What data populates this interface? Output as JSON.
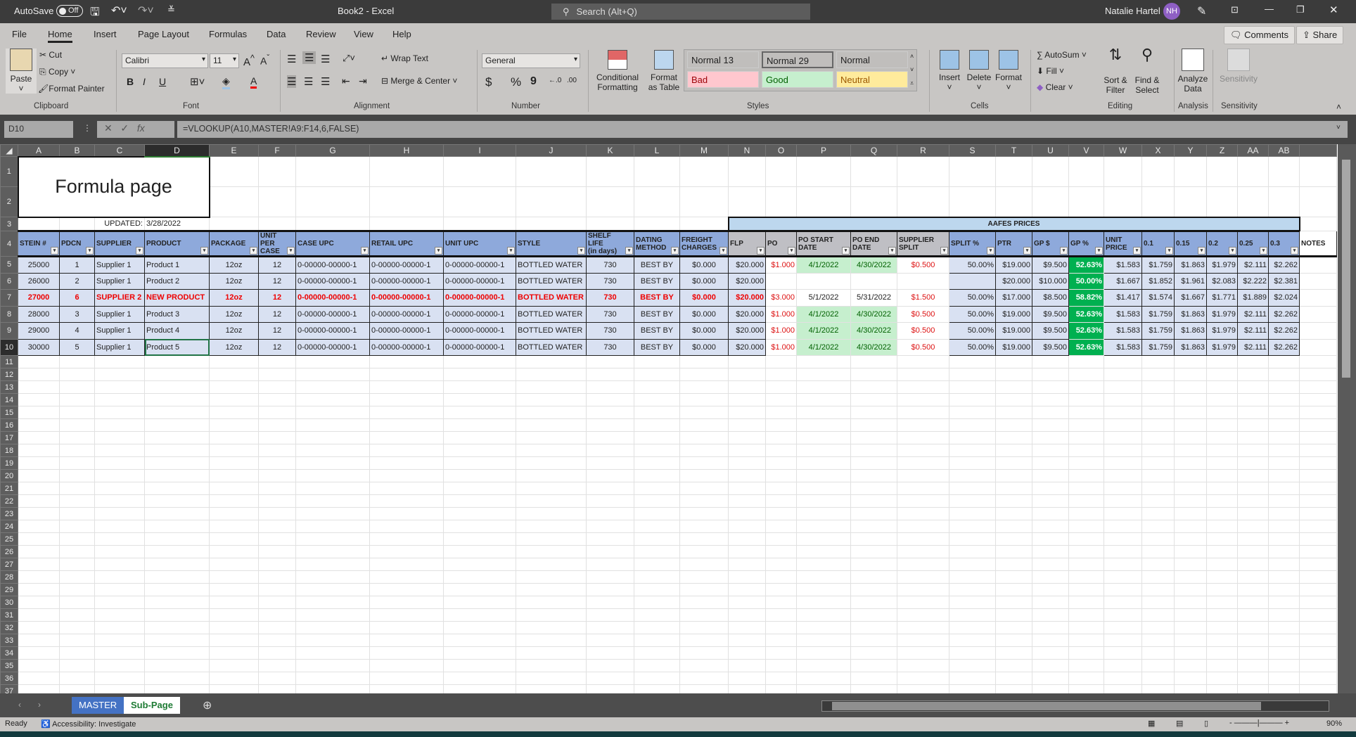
{
  "title_bar": {
    "autosave_label": "AutoSave",
    "autosave_state": "Off",
    "doc_title": "Book2  -  Excel",
    "search_placeholder": "Search (Alt+Q)",
    "user_name": "Natalie Hartel",
    "user_initials": "NH"
  },
  "menu_tabs": [
    "File",
    "Home",
    "Insert",
    "Page Layout",
    "Formulas",
    "Data",
    "Review",
    "View",
    "Help"
  ],
  "active_tab": "Home",
  "comments_label": "Comments",
  "share_label": "Share",
  "ribbon": {
    "clipboard": {
      "paste": "Paste",
      "cut": "Cut",
      "copy": "Copy",
      "format_painter": "Format Painter",
      "label": "Clipboard"
    },
    "font": {
      "name": "Calibri",
      "size": "11",
      "bold": "B",
      "italic": "I",
      "underline": "U",
      "label": "Font"
    },
    "alignment": {
      "wrap_text": "Wrap Text",
      "merge_center": "Merge & Center",
      "label": "Alignment"
    },
    "number": {
      "format": "General",
      "currency": "$",
      "percent": "%",
      "comma": "9",
      "label": "Number"
    },
    "styles": {
      "conditional": "Conditional Formatting",
      "format_table": "Format as Table",
      "gallery": [
        {
          "name": "Normal 13",
          "bg": "#ffffff",
          "fg": "#000000"
        },
        {
          "name": "Normal 29",
          "bg": "#ffffff",
          "fg": "#000000"
        },
        {
          "name": "Normal",
          "bg": "#ffffff",
          "fg": "#000000"
        },
        {
          "name": "Bad",
          "bg": "#ffc7ce",
          "fg": "#9c0006"
        },
        {
          "name": "Good",
          "bg": "#c6efce",
          "fg": "#006100"
        },
        {
          "name": "Neutral",
          "bg": "#ffeb9c",
          "fg": "#9c5700"
        }
      ],
      "label": "Styles"
    },
    "cells": {
      "insert": "Insert",
      "delete": "Delete",
      "format": "Format",
      "label": "Cells"
    },
    "editing": {
      "autosum": "AutoSum",
      "fill": "Fill",
      "clear": "Clear",
      "sort_filter": "Sort & Filter",
      "find_select": "Find & Select",
      "label": "Editing"
    },
    "analysis": {
      "analyze": "Analyze Data",
      "label": "Analysis"
    },
    "sensitivity": {
      "button": "Sensitivity",
      "label": "Sensitivity"
    }
  },
  "formula_bar": {
    "name_box": "D10",
    "fx": "fx",
    "formula": "=VLOOKUP(A10,MASTER!A9:F14,6,FALSE)"
  },
  "sheet": {
    "columns": [
      "A",
      "B",
      "C",
      "D",
      "E",
      "F",
      "G",
      "H",
      "I",
      "J",
      "K",
      "L",
      "M",
      "N",
      "O",
      "P",
      "Q",
      "R",
      "S",
      "T",
      "U",
      "V",
      "W",
      "X",
      "Y",
      "Z",
      "AA",
      "AB",
      ""
    ],
    "selected_column": "D",
    "selected_row": 10,
    "row_count": 37,
    "title": "Formula page",
    "updated_label": "UPDATED:",
    "updated_date": "3/28/2022",
    "group_header": "AAFES PRICES",
    "headers": [
      "STEIN #",
      "PDCN",
      "SUPPLIER",
      "PRODUCT",
      "PACKAGE",
      "UNIT PER\nCASE",
      "CASE UPC",
      "RETAIL UPC",
      "UNIT UPC",
      "STYLE",
      "SHELF LIFE\n(in days)",
      "DATING\nMETHOD",
      "FREIGHT\nCHARGES",
      "FLP",
      "PO",
      "PO START\nDATE",
      "PO END\nDATE",
      "SUPPLIER\nSPLIT",
      "SPLIT %",
      "PTR",
      "GP $",
      "GP %",
      "UNIT\nPRICE",
      "0.1",
      "0.15",
      "0.2",
      "0.25",
      "0.3",
      "NOTES"
    ],
    "rows": [
      {
        "highlight": false,
        "cells": [
          "25000",
          "1",
          "Supplier 1",
          "Product 1",
          "12oz",
          "12",
          "0-00000-00000-1",
          "0-00000-00000-1",
          "0-00000-00000-1",
          "BOTTLED WATER",
          "730",
          "BEST BY",
          "$0.000",
          "$20.000",
          "$1.000",
          "4/1/2022",
          "4/30/2022",
          "$0.500",
          "50.00%",
          "$19.000",
          "$9.500",
          "52.63%",
          "$1.583",
          "$1.759",
          "$1.863",
          "$1.979",
          "$2.111",
          "$2.262",
          ""
        ]
      },
      {
        "highlight": false,
        "cells": [
          "26000",
          "2",
          "Supplier 1",
          "Product 2",
          "12oz",
          "12",
          "0-00000-00000-1",
          "0-00000-00000-1",
          "0-00000-00000-1",
          "BOTTLED WATER",
          "730",
          "BEST BY",
          "$0.000",
          "$20.000",
          "",
          "",
          "",
          "",
          "",
          "$20.000",
          "$10.000",
          "50.00%",
          "$1.667",
          "$1.852",
          "$1.961",
          "$2.083",
          "$2.222",
          "$2.381",
          ""
        ]
      },
      {
        "highlight": true,
        "cells": [
          "27000",
          "6",
          "SUPPLIER 2",
          "NEW PRODUCT",
          "12oz",
          "12",
          "0-00000-00000-1",
          "0-00000-00000-1",
          "0-00000-00000-1",
          "BOTTLED WATER",
          "730",
          "BEST BY",
          "$0.000",
          "$20.000",
          "$3.000",
          "5/1/2022",
          "5/31/2022",
          "$1.500",
          "50.00%",
          "$17.000",
          "$8.500",
          "58.82%",
          "$1.417",
          "$1.574",
          "$1.667",
          "$1.771",
          "$1.889",
          "$2.024",
          ""
        ]
      },
      {
        "highlight": false,
        "cells": [
          "28000",
          "3",
          "Supplier 1",
          "Product 3",
          "12oz",
          "12",
          "0-00000-00000-1",
          "0-00000-00000-1",
          "0-00000-00000-1",
          "BOTTLED WATER",
          "730",
          "BEST BY",
          "$0.000",
          "$20.000",
          "$1.000",
          "4/1/2022",
          "4/30/2022",
          "$0.500",
          "50.00%",
          "$19.000",
          "$9.500",
          "52.63%",
          "$1.583",
          "$1.759",
          "$1.863",
          "$1.979",
          "$2.111",
          "$2.262",
          ""
        ]
      },
      {
        "highlight": false,
        "cells": [
          "29000",
          "4",
          "Supplier 1",
          "Product 4",
          "12oz",
          "12",
          "0-00000-00000-1",
          "0-00000-00000-1",
          "0-00000-00000-1",
          "BOTTLED WATER",
          "730",
          "BEST BY",
          "$0.000",
          "$20.000",
          "$1.000",
          "4/1/2022",
          "4/30/2022",
          "$0.500",
          "50.00%",
          "$19.000",
          "$9.500",
          "52.63%",
          "$1.583",
          "$1.759",
          "$1.863",
          "$1.979",
          "$2.111",
          "$2.262",
          ""
        ]
      },
      {
        "highlight": false,
        "cells": [
          "30000",
          "5",
          "Supplier 1",
          "Product 5",
          "12oz",
          "12",
          "0-00000-00000-1",
          "0-00000-00000-1",
          "0-00000-00000-1",
          "BOTTLED WATER",
          "730",
          "BEST BY",
          "$0.000",
          "$20.000",
          "$1.000",
          "4/1/2022",
          "4/30/2022",
          "$0.500",
          "50.00%",
          "$19.000",
          "$9.500",
          "52.63%",
          "$1.583",
          "$1.759",
          "$1.863",
          "$1.979",
          "$2.111",
          "$2.262",
          ""
        ]
      }
    ]
  },
  "sheet_tabs": [
    "MASTER",
    "Sub-Page"
  ],
  "active_sheet": "Sub-Page",
  "status": {
    "ready": "Ready",
    "accessibility": "Accessibility: Investigate",
    "zoom": "90%"
  },
  "colors": {
    "header_blue": "#8ea9db",
    "header_grey": "#bfbfc4",
    "row_blue": "#d9e1f2",
    "good_green": "#c6efce",
    "gp_green": "#00b050",
    "aafes_blue": "#bdd7ee",
    "alert_red": "#e00000",
    "master_tab": "#4472c4"
  }
}
